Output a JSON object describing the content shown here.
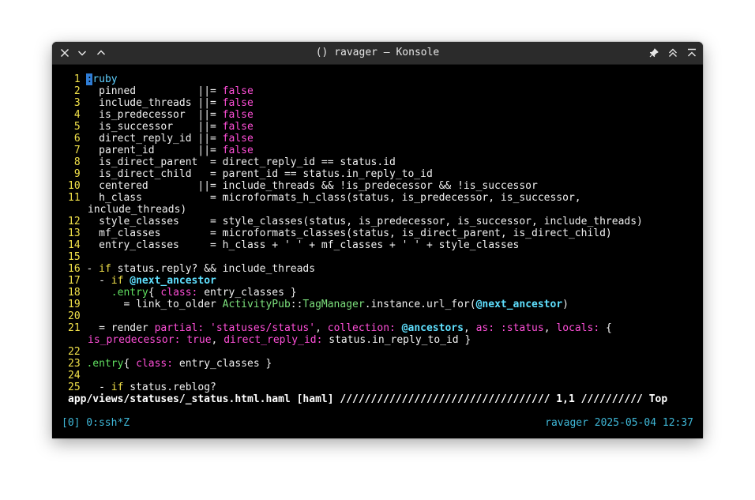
{
  "window": {
    "title": "() ravager — Konsole"
  },
  "icons": {
    "close": "close-icon",
    "minimize": "chevron-down-icon",
    "maximize": "chevron-up-icon",
    "pin": "pin-icon",
    "keep_above": "double-chevron-up-icon",
    "keep_below": "chevron-up-bar-icon"
  },
  "editor": {
    "lines": [
      {
        "num": "1",
        "segs": [
          {
            "t": ":",
            "c": "cursor"
          },
          {
            "t": "ruby",
            "c": "c-dir"
          }
        ]
      },
      {
        "num": "2",
        "segs": [
          {
            "t": "  pinned          ||= "
          },
          {
            "t": "false",
            "c": "c-bool"
          }
        ]
      },
      {
        "num": "3",
        "segs": [
          {
            "t": "  include_threads ||= "
          },
          {
            "t": "false",
            "c": "c-bool"
          }
        ]
      },
      {
        "num": "4",
        "segs": [
          {
            "t": "  is_predecessor  ||= "
          },
          {
            "t": "false",
            "c": "c-bool"
          }
        ]
      },
      {
        "num": "5",
        "segs": [
          {
            "t": "  is_successor    ||= "
          },
          {
            "t": "false",
            "c": "c-bool"
          }
        ]
      },
      {
        "num": "6",
        "segs": [
          {
            "t": "  direct_reply_id ||= "
          },
          {
            "t": "false",
            "c": "c-bool"
          }
        ]
      },
      {
        "num": "7",
        "segs": [
          {
            "t": "  parent_id       ||= "
          },
          {
            "t": "false",
            "c": "c-bool"
          }
        ]
      },
      {
        "num": "8",
        "segs": [
          {
            "t": "  is_direct_parent  = direct_reply_id == status.id"
          }
        ]
      },
      {
        "num": "9",
        "segs": [
          {
            "t": "  is_direct_child   = parent_id == status.in_reply_to_id"
          }
        ]
      },
      {
        "num": "10",
        "segs": [
          {
            "t": "  centered        ||= include_threads && !is_predecessor && !is_successor"
          }
        ]
      },
      {
        "num": "11",
        "segs": [
          {
            "t": "  h_class           = microformats_h_class(status, is_predecessor, is_successor,"
          }
        ]
      },
      {
        "num": "",
        "segs": [
          {
            "t": "include_threads)"
          }
        ]
      },
      {
        "num": "12",
        "segs": [
          {
            "t": "  style_classes     = style_classes(status, is_predecessor, is_successor, include_threads)"
          }
        ]
      },
      {
        "num": "13",
        "segs": [
          {
            "t": "  mf_classes        = microformats_classes(status, is_direct_parent, is_direct_child)"
          }
        ]
      },
      {
        "num": "14",
        "segs": [
          {
            "t": "  entry_classes     = h_class + ' ' + mf_classes + ' ' + style_classes"
          }
        ]
      },
      {
        "num": "15",
        "segs": [
          {
            "t": ""
          }
        ]
      },
      {
        "num": "16",
        "segs": [
          {
            "t": "- "
          },
          {
            "t": "if",
            "c": "c-kw"
          },
          {
            "t": " status.reply? && include_threads"
          }
        ]
      },
      {
        "num": "17",
        "segs": [
          {
            "t": "  - "
          },
          {
            "t": "if",
            "c": "c-kw"
          },
          {
            "t": " "
          },
          {
            "t": "@next_ancestor",
            "c": "c-ivar"
          }
        ]
      },
      {
        "num": "18",
        "segs": [
          {
            "t": "    "
          },
          {
            "t": ".entry",
            "c": "c-class"
          },
          {
            "t": "{ "
          },
          {
            "t": "class:",
            "c": "c-key"
          },
          {
            "t": " entry_classes }"
          }
        ]
      },
      {
        "num": "19",
        "segs": [
          {
            "t": "      = link_to_older "
          },
          {
            "t": "ActivityPub",
            "c": "c-const"
          },
          {
            "t": "::"
          },
          {
            "t": "TagManager",
            "c": "c-const"
          },
          {
            "t": ".instance.url_for("
          },
          {
            "t": "@next_ancestor",
            "c": "c-ivar"
          },
          {
            "t": ")"
          }
        ]
      },
      {
        "num": "20",
        "segs": [
          {
            "t": ""
          }
        ]
      },
      {
        "num": "21",
        "segs": [
          {
            "t": "  = render "
          },
          {
            "t": "partial:",
            "c": "c-key"
          },
          {
            "t": " "
          },
          {
            "t": "'statuses/status'",
            "c": "c-str"
          },
          {
            "t": ", "
          },
          {
            "t": "collection:",
            "c": "c-key"
          },
          {
            "t": " "
          },
          {
            "t": "@ancestors",
            "c": "c-ivar"
          },
          {
            "t": ", "
          },
          {
            "t": "as:",
            "c": "c-key"
          },
          {
            "t": " "
          },
          {
            "t": ":status",
            "c": "c-sym"
          },
          {
            "t": ", "
          },
          {
            "t": "locals:",
            "c": "c-key"
          },
          {
            "t": " {"
          }
        ]
      },
      {
        "num": "",
        "segs": [
          {
            "t": "is_predecessor:",
            "c": "c-key"
          },
          {
            "t": " "
          },
          {
            "t": "true",
            "c": "c-bool"
          },
          {
            "t": ", "
          },
          {
            "t": "direct_reply_id:",
            "c": "c-key"
          },
          {
            "t": " status.in_reply_to_id }"
          }
        ]
      },
      {
        "num": "22",
        "segs": [
          {
            "t": ""
          }
        ]
      },
      {
        "num": "23",
        "segs": [
          {
            "t": ".entry",
            "c": "c-class"
          },
          {
            "t": "{ "
          },
          {
            "t": "class:",
            "c": "c-key"
          },
          {
            "t": " entry_classes }"
          }
        ]
      },
      {
        "num": "24",
        "segs": [
          {
            "t": ""
          }
        ]
      },
      {
        "num": "25",
        "segs": [
          {
            "t": "  - "
          },
          {
            "t": "if",
            "c": "c-kw"
          },
          {
            "t": " status.reblog?"
          }
        ]
      }
    ],
    "statusline": "app/views/statuses/_status.html.haml [haml] ////////////////////////////////// 1,1 ////////// Top"
  },
  "tmux": {
    "left": "[0] 0:ssh*Z",
    "right": "ravager 2025-05-04 12:37"
  }
}
